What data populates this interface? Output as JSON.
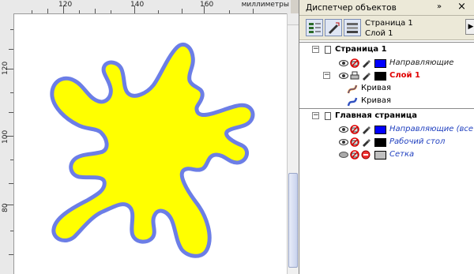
{
  "ruler": {
    "top_labels": [
      "120",
      "140",
      "160"
    ],
    "units": "миллиметры",
    "left_labels": [
      "120",
      "100",
      "80"
    ]
  },
  "canvas": {
    "blob_fill": "#ffff00",
    "blob_outline": "#6c7ee6"
  },
  "docker": {
    "title": "Диспетчер объектов",
    "arrows": "»",
    "close": "×",
    "toolbar": {
      "current_page": "Страница 1",
      "current_layer": "Слой 1",
      "menu_arrow": "▶"
    },
    "tree": {
      "page1": {
        "label": "Страница 1",
        "guides_label": "Направляющие",
        "guides_color": "#0000ff",
        "layer1_label": "Слой 1",
        "layer1_color": "#000000",
        "curve1_label": "Кривая",
        "curve2_label": "Кривая"
      },
      "master": {
        "label": "Главная страница",
        "guides_all_label": "Направляющие (все ст",
        "guides_all_color": "#0000ff",
        "desktop_label": "Рабочий стол",
        "desktop_color": "#000000",
        "grid_label": "Сетка",
        "grid_color": "#c0c0c0"
      }
    }
  }
}
